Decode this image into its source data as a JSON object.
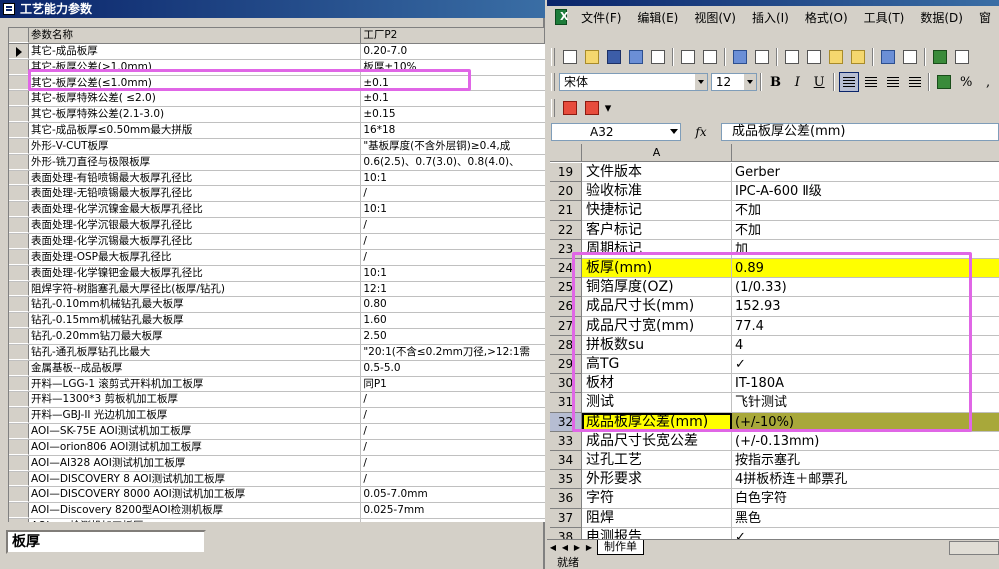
{
  "left_window": {
    "title": "工艺能力参数",
    "header": {
      "col1": "参数名称",
      "col2": "工厂P2"
    },
    "rows": [
      {
        "name": "其它-成品板厚",
        "value": "0.20-7.0"
      },
      {
        "name": "其它-板厚公差(>1.0mm)",
        "value": "板厚±10%"
      },
      {
        "name": "其它-板厚公差(≤1.0mm)",
        "value": "±0.1"
      },
      {
        "name": "其它-板厚特殊公差( ≤2.0)",
        "value": "±0.1"
      },
      {
        "name": "其它-板厚特殊公差(2.1-3.0)",
        "value": "±0.15"
      },
      {
        "name": "其它-成品板厚≤0.50mm最大拼版",
        "value": "16*18"
      },
      {
        "name": "外形-V-CUT板厚",
        "value": "\"基板厚度(不含外层铜)≥0.4,成"
      },
      {
        "name": "外形-铣刀直径与极限板厚",
        "value": "0.6(2.5)、0.7(3.0)、0.8(4.0)、"
      },
      {
        "name": "表面处理-有铅喷锡最大板厚孔径比",
        "value": "10:1"
      },
      {
        "name": "表面处理-无铅喷锡最大板厚孔径比",
        "value": "/"
      },
      {
        "name": "表面处理-化学沉镍金最大板厚孔径比",
        "value": "10:1"
      },
      {
        "name": "表面处理-化学沉银最大板厚孔径比",
        "value": "/"
      },
      {
        "name": "表面处理-化学沉锡最大板厚孔径比",
        "value": "/"
      },
      {
        "name": "表面处理-OSP最大板厚孔径比",
        "value": "/"
      },
      {
        "name": "表面处理-化学镍钯金最大板厚孔径比",
        "value": "10:1"
      },
      {
        "name": "阻焊字符-树脂塞孔最大厚径比(板厚/钻孔)",
        "value": "12:1"
      },
      {
        "name": "钻孔-0.10mm机械钻孔最大板厚",
        "value": "0.80"
      },
      {
        "name": "钻孔-0.15mm机械钻孔最大板厚",
        "value": "1.60"
      },
      {
        "name": "钻孔-0.20mm钻刀最大板厚",
        "value": "2.50"
      },
      {
        "name": "钻孔-通孔板厚钻孔比最大",
        "value": "\"20:1(不含≤0.2mm刀径,>12:1需"
      },
      {
        "name": "金属基板--成品板厚",
        "value": "0.5-5.0"
      },
      {
        "name": "开料—LGG-1  滚剪式开料机加工板厚",
        "value": "同P1"
      },
      {
        "name": "开料—1300*3  剪板机加工板厚",
        "value": "/"
      },
      {
        "name": "开料—GBJ-II  光边机加工板厚",
        "value": "/"
      },
      {
        "name": "AOI—SK-75E AOI测试机加工板厚",
        "value": "/"
      },
      {
        "name": "AOI—orion806  AOI测试机加工板厚",
        "value": "/"
      },
      {
        "name": "AOI—AI328 AOI测试机加工板厚",
        "value": "/"
      },
      {
        "name": "AOI—DISCOVERY 8 AOI测试机加工板厚",
        "value": "/"
      },
      {
        "name": "AOI—DISCOVERY 8000 AOI测试机加工板厚",
        "value": "0.05-7.0mm"
      },
      {
        "name": "AOI—Discovery 8200型AOI检测机板厚",
        "value": "0.025-7mm"
      },
      {
        "name": "AOI—...检测机加工板厚",
        "value": "..."
      }
    ],
    "search_value": "板厚"
  },
  "right_window": {
    "menu": [
      "文件(F)",
      "编辑(E)",
      "视图(V)",
      "插入(I)",
      "格式(O)",
      "工具(T)",
      "数据(D)",
      "窗"
    ],
    "font_name": "宋体",
    "font_size": "12",
    "name_box": "A32",
    "fx_label": "fx",
    "formula_value": "成品板厚公差(mm)",
    "column_header": "A",
    "rows": [
      {
        "num": "19",
        "a": "文件版本",
        "b": "Gerber",
        "style": ""
      },
      {
        "num": "20",
        "a": "验收标准",
        "b": "IPC-A-600 Ⅱ级",
        "style": ""
      },
      {
        "num": "21",
        "a": "快捷标记",
        "b": "不加",
        "style": ""
      },
      {
        "num": "22",
        "a": "客户标记",
        "b": "不加",
        "style": ""
      },
      {
        "num": "23",
        "a": "周期标记",
        "b": "加",
        "style": ""
      },
      {
        "num": "24",
        "a": "板厚(mm)",
        "b": "0.89",
        "style": "yellow"
      },
      {
        "num": "25",
        "a": "铜箔厚度(OZ)",
        "b": " (1/0.33)",
        "style": ""
      },
      {
        "num": "26",
        "a": "成品尺寸长(mm)",
        "b": "152.93",
        "style": ""
      },
      {
        "num": "27",
        "a": "成品尺寸宽(mm)",
        "b": "77.4",
        "style": ""
      },
      {
        "num": "28",
        "a": "拼板数su",
        "b": "4",
        "style": ""
      },
      {
        "num": "29",
        "a": "高TG",
        "b": "✓",
        "style": ""
      },
      {
        "num": "30",
        "a": "板材",
        "b": "IT-180A",
        "style": ""
      },
      {
        "num": "31",
        "a": "测试",
        "b": "飞针测试",
        "style": ""
      },
      {
        "num": "32",
        "a": "成品板厚公差(mm)",
        "b": "(+/-10%)",
        "style": "olive active"
      },
      {
        "num": "33",
        "a": "成品尺寸长宽公差",
        "b": "(+/-0.13mm)",
        "style": ""
      },
      {
        "num": "34",
        "a": "过孔工艺",
        "b": "按指示塞孔",
        "style": ""
      },
      {
        "num": "35",
        "a": "外形要求",
        "b": "4拼板桥连＋邮票孔",
        "style": ""
      },
      {
        "num": "36",
        "a": "字符",
        "b": "白色字符",
        "style": ""
      },
      {
        "num": "37",
        "a": "阻焊",
        "b": "黑色",
        "style": ""
      },
      {
        "num": "38",
        "a": "电测报告",
        "b": "✓",
        "style": ""
      }
    ],
    "sheet_tab": "制作单",
    "status": "就绪"
  },
  "colors": {
    "highlight_box": "#e066e6",
    "yellow_fill": "#ffff00",
    "olive_fill": "#a8a83a",
    "title_bar": "#0a246a"
  }
}
